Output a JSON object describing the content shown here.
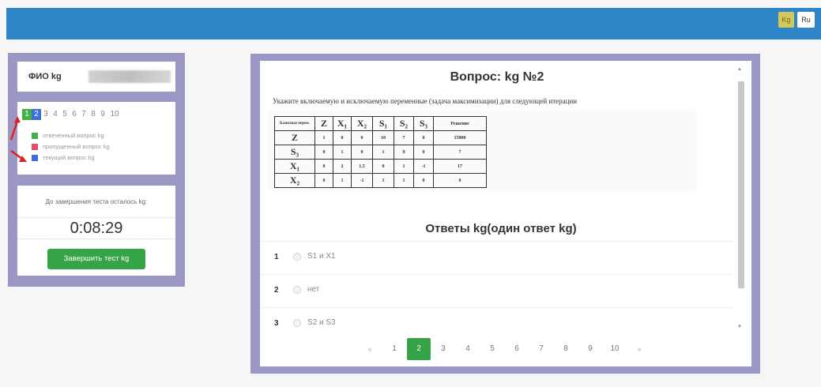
{
  "lang": {
    "kg": "Kg",
    "ru": "Ru"
  },
  "sidebar": {
    "fio_label": "ФИО kg",
    "question_numbers": [
      "1",
      "2",
      "3",
      "4",
      "5",
      "6",
      "7",
      "8",
      "9",
      "10"
    ],
    "legend": [
      {
        "label": "отвеченный вопрос kg",
        "color": "#44b04a"
      },
      {
        "label": "пропущенный вопрос kg",
        "color": "#e0506a"
      },
      {
        "label": "текущий вопрос kg",
        "color": "#3f6fd8"
      }
    ],
    "timer_label": "До завершения теста осталось kg:",
    "timer_value": "0:08:29",
    "finish_button": "Завершить тест kg"
  },
  "question": {
    "title": "Вопрос: kg №2",
    "text": "Укажите включаемую и исключаемую переменные (задача максимизации) для следующей итерации",
    "table": {
      "header": [
        "Базисные перем.",
        "Z",
        "X₁",
        "X₂",
        "S₁",
        "S₂",
        "S₃",
        "Решение"
      ],
      "rows": [
        [
          "Z",
          "1",
          "0",
          "0",
          "10",
          "7",
          "0",
          "15000"
        ],
        [
          "S₃",
          "0",
          "1",
          "0",
          "1",
          "0",
          "0",
          "7"
        ],
        [
          "X₁",
          "0",
          "2",
          "1,5",
          "0",
          "1",
          "-1",
          "17"
        ],
        [
          "X₂",
          "0",
          "1",
          "-1",
          "1",
          "1",
          "0",
          "0"
        ]
      ]
    }
  },
  "answers": {
    "title": "Ответы kg(один ответ kg)",
    "items": [
      {
        "num": "1",
        "text": "S1 и X1"
      },
      {
        "num": "2",
        "text": "нет"
      },
      {
        "num": "3",
        "text": "S2 и S3"
      }
    ]
  },
  "pager": {
    "prev": "«",
    "next": "»",
    "pages": [
      "1",
      "2",
      "3",
      "4",
      "5",
      "6",
      "7",
      "8",
      "9",
      "10"
    ],
    "active": "2"
  }
}
